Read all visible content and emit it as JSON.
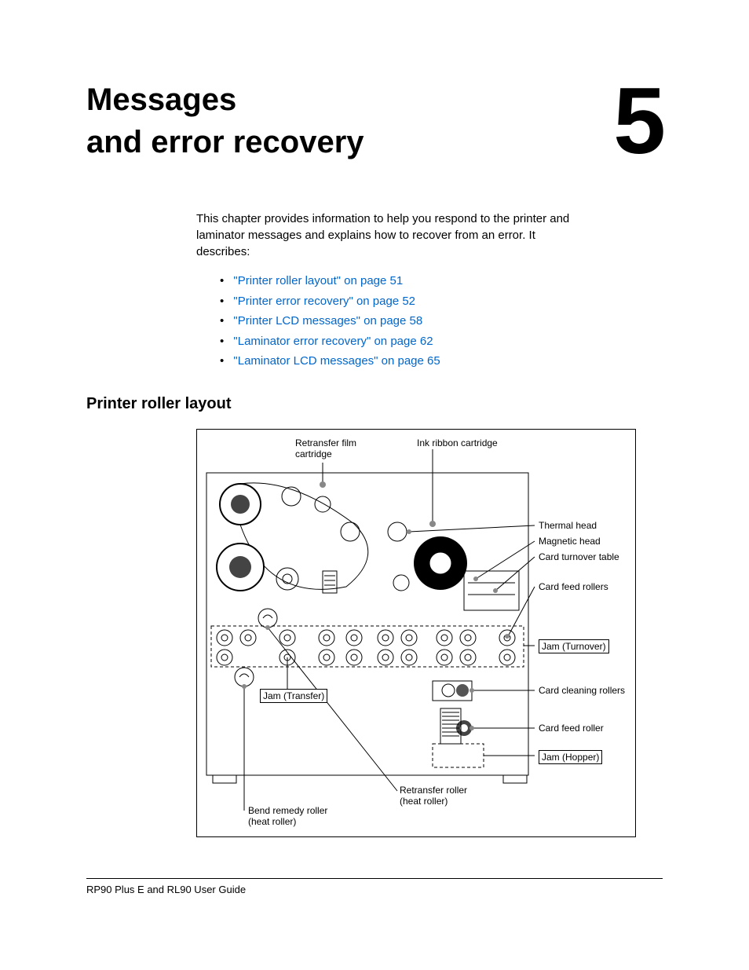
{
  "chapter": {
    "title_line1": "Messages",
    "title_line2": "and error recovery",
    "number": "5"
  },
  "intro": "This chapter provides information to help you respond to the printer and laminator messages and explains how to recover from an error. It describes:",
  "toc": [
    "\"Printer roller layout\" on page 51",
    "\"Printer error recovery\" on page 52",
    "\"Printer LCD messages\" on page 58",
    "\"Laminator error recovery\" on page 62",
    "\"Laminator LCD messages\" on page 65"
  ],
  "section_heading": "Printer roller layout",
  "diagram": {
    "top_labels": {
      "retransfer_film_cartridge": "Retransfer film\ncartridge",
      "ink_ribbon_cartridge": "Ink ribbon cartridge"
    },
    "right_labels": {
      "thermal_head": "Thermal head",
      "magnetic_head": "Magnetic head",
      "card_turnover_table": "Card turnover table",
      "card_feed_rollers": "Card feed rollers",
      "jam_turnover": "Jam (Turnover)",
      "card_cleaning_rollers": "Card cleaning rollers",
      "card_feed_roller": "Card feed roller",
      "jam_hopper": "Jam (Hopper)"
    },
    "inner_labels": {
      "jam_transfer": "Jam (Transfer)"
    },
    "bottom_labels": {
      "retransfer_roller": "Retransfer roller\n(heat roller)",
      "bend_remedy_roller": "Bend remedy roller\n(heat roller)"
    }
  },
  "footer": "RP90 Plus E and RL90 User Guide"
}
